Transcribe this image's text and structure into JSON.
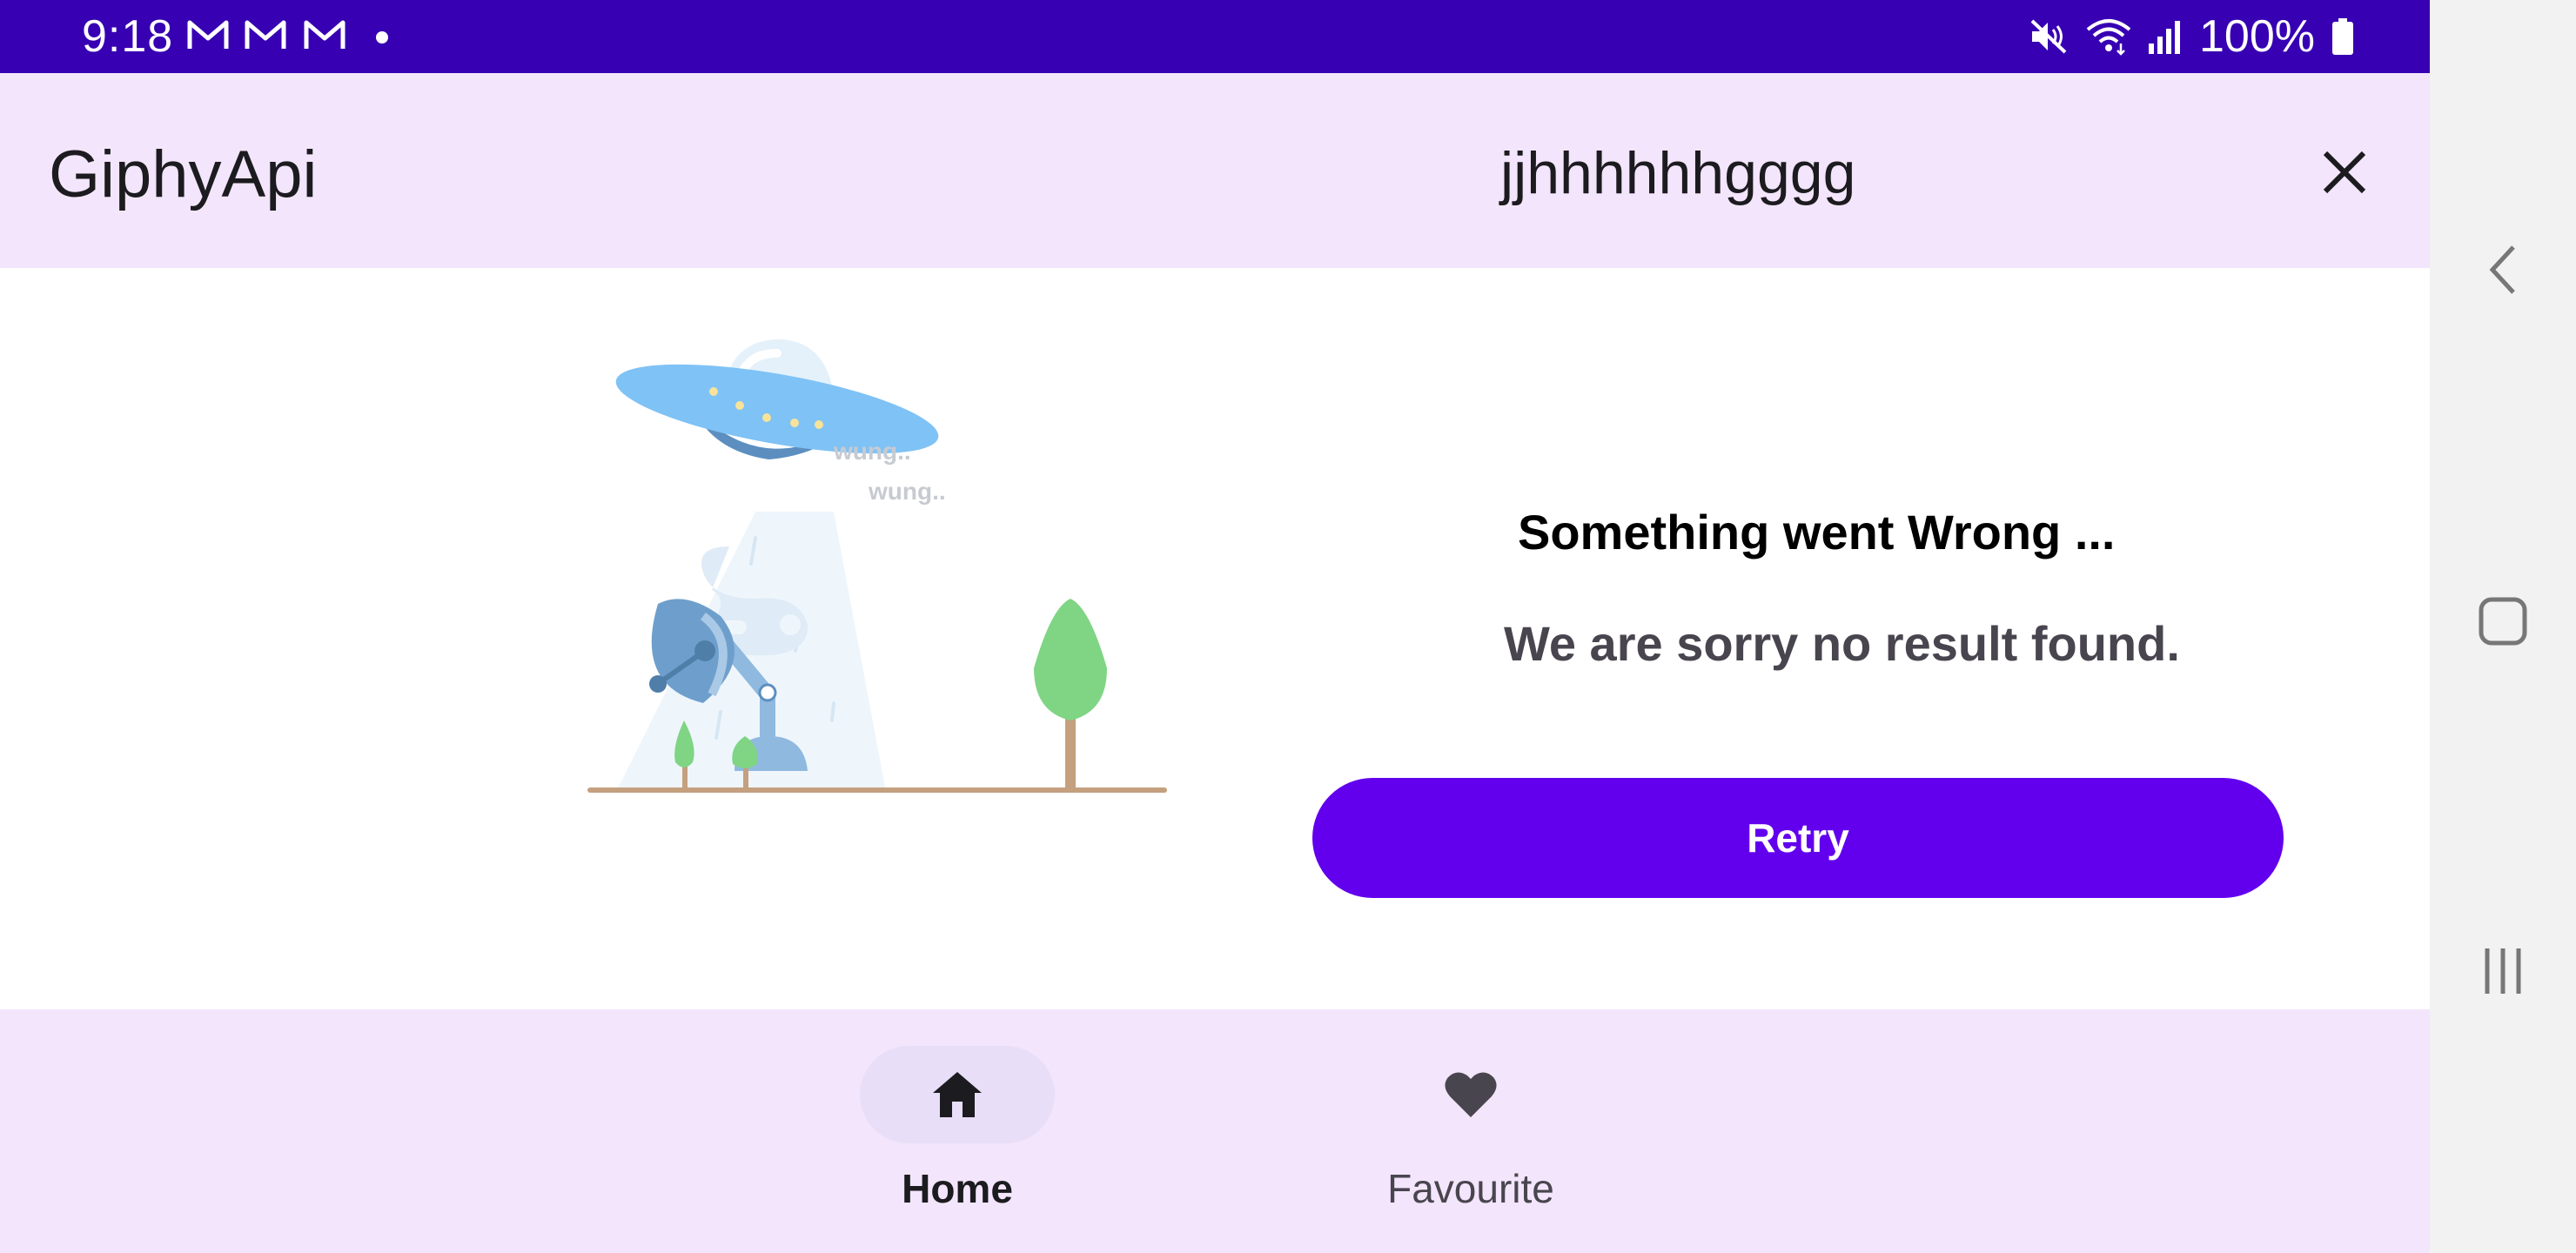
{
  "status_bar": {
    "time": "9:18",
    "notification_icons": [
      "gmail-icon",
      "gmail-icon",
      "gmail-icon",
      "more-notifications-dot"
    ],
    "battery": "100%",
    "icons": [
      "mute-icon",
      "wifi-icon",
      "signal-icon",
      "battery-icon"
    ],
    "background_color": "#3700b3"
  },
  "app_bar": {
    "title": "GiphyApi",
    "search_query": "jjhhhhhhgggg",
    "close_icon": "close-icon",
    "background_color": "#f3e5fb"
  },
  "error": {
    "title": "Something went Wrong ...",
    "message": "We are sorry no result found.",
    "retry_label": "Retry",
    "illustration": "ufo-beaming-satellite-dish",
    "illustration_text": [
      "wung..",
      "wung.."
    ],
    "accent_color": "#6200ee"
  },
  "bottom_nav": {
    "items": [
      {
        "label": "Home",
        "icon": "home-icon",
        "selected": true
      },
      {
        "label": "Favourite",
        "icon": "heart-icon",
        "selected": false
      }
    ]
  },
  "system_nav": {
    "buttons": [
      "back-icon",
      "home-icon",
      "recents-icon"
    ]
  }
}
